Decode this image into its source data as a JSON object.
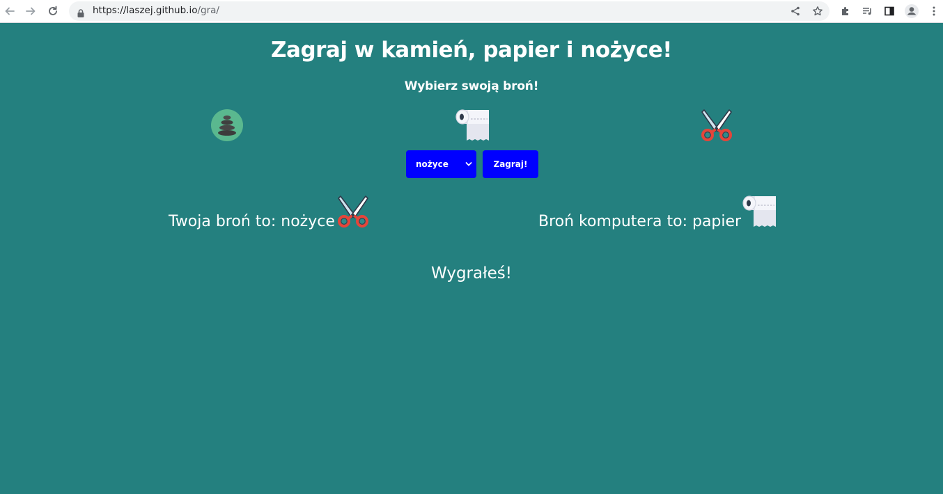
{
  "browser": {
    "url_host": "https://laszej.github.io",
    "url_path": "/gra/"
  },
  "page": {
    "title": "Zagraj w kamień, papier i nożyce!",
    "subtitle": "Wybierz swoją broń!",
    "weapons": [
      {
        "name": "kamień",
        "icon": "rock-icon"
      },
      {
        "name": "papier",
        "icon": "toilet-paper-icon"
      },
      {
        "name": "nożyce",
        "icon": "scissors-icon"
      }
    ],
    "select": {
      "selected": "nożyce"
    },
    "play_button": "Zagraj!",
    "player_label": "Twoja broń to: nożyce",
    "computer_label": "Broń komputera to: papier",
    "verdict": "Wygrałeś!"
  },
  "colors": {
    "background": "#24807f",
    "button": "#0000ff",
    "text": "#ffffff"
  }
}
